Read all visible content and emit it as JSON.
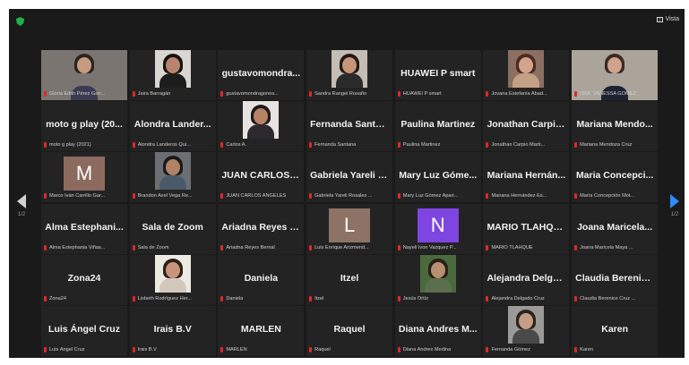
{
  "toolbar": {
    "view_label": "Vista"
  },
  "pagination": {
    "left_page": "1/2",
    "right_page": "1/2"
  },
  "tiles": [
    {
      "big": "",
      "small": "Gloria Edith Pérez Garr...",
      "kind": "photo",
      "bg": "#7a7570",
      "skin": "#c79a82",
      "hair": "#2b2420",
      "shirt": "#3a3a50"
    },
    {
      "big": "",
      "small": "Jaira Barragán",
      "kind": "photo",
      "bg": "#d9d6d2",
      "skin": "#b9846d",
      "hair": "#161413",
      "shirt": "#1d1d1d"
    },
    {
      "big": "gustavomondra...",
      "small": "gustavomondragones...",
      "kind": "text"
    },
    {
      "big": "",
      "small": "Sandra Rangel Rosaño",
      "kind": "photo",
      "bg": "#c3bdb5",
      "skin": "#c89478",
      "hair": "#201915",
      "shirt": "#2b2b2b"
    },
    {
      "big": "HUAWEI P smart",
      "small": "HUAWEI P smart",
      "kind": "text"
    },
    {
      "big": "",
      "small": "Jovana Estefanía Abad...",
      "kind": "photo",
      "bg": "#8a6f62",
      "skin": "#d4a38c",
      "hair": "#4a2b20",
      "shirt": "#c4a084"
    },
    {
      "big": "",
      "small": "DRA. VANESSA GÓMEZ",
      "kind": "photo",
      "bg": "#aaa49b",
      "skin": "#d0a38d",
      "hair": "#3a2a22",
      "shirt": "#1e2230",
      "speaking": true
    },
    {
      "big": "moto g play (20...",
      "small": "moto g play (2021)",
      "kind": "text"
    },
    {
      "big": "Alondra Lander...",
      "small": "Alondra Landeros Qui...",
      "kind": "text"
    },
    {
      "big": "",
      "small": "Carlos A.",
      "kind": "photo",
      "bg": "#e6e3e0",
      "skin": "#b78266",
      "hair": "#1e1b18",
      "shirt": "#2c2a2e"
    },
    {
      "big": "Fernanda Santana",
      "small": "Fernanda Santana",
      "kind": "text"
    },
    {
      "big": "Paulina Martinez",
      "small": "Paulina Martinez",
      "kind": "text"
    },
    {
      "big": "Jonathan Carpio...",
      "small": "Jonathan Carpio Marti...",
      "kind": "text"
    },
    {
      "big": "Mariana Mendo...",
      "small": "Mariana Mendoza Cruz",
      "kind": "text"
    },
    {
      "big": "",
      "small": "Marco Iván Carrillo Gar...",
      "kind": "letter",
      "letter": "M",
      "color": "#8c6b5e"
    },
    {
      "big": "",
      "small": "Brandon Axel Vega Re...",
      "kind": "photo",
      "bg": "#6b6f73",
      "skin": "#b08266",
      "hair": "#1a1a1a",
      "shirt": "#4b5a6b"
    },
    {
      "big": "JUAN CARLOS A...",
      "small": "JUAN CARLOS ANGELES",
      "kind": "text"
    },
    {
      "big": "Gabriela Yareli R...",
      "small": "Gabriela Yareli Rosales ...",
      "kind": "text"
    },
    {
      "big": "Mary Luz Góme...",
      "small": "Mary Luz Gómez Apari...",
      "kind": "text"
    },
    {
      "big": "Mariana Hernán...",
      "small": "Mariana Hernández Es...",
      "kind": "text"
    },
    {
      "big": "Maria Concepci...",
      "small": "María Concepción Mot...",
      "kind": "text"
    },
    {
      "big": "Alma Estephani...",
      "small": "Alma Estephania Viñas...",
      "kind": "text"
    },
    {
      "big": "Sala de Zoom",
      "small": "Sala de Zoom",
      "kind": "text"
    },
    {
      "big": "Ariadna Reyes B...",
      "small": "Ariadna Reyes Bernal",
      "kind": "text"
    },
    {
      "big": "",
      "small": "Luis Enrique Arizmend...",
      "kind": "letter",
      "letter": "L",
      "color": "#8e7266"
    },
    {
      "big": "",
      "small": "Nayeli Ivon Vazquez P...",
      "kind": "letter",
      "letter": "N",
      "color": "#7e45e0"
    },
    {
      "big": "MARIO TLAHQUE",
      "small": "MARIO TLAHQUE",
      "kind": "text"
    },
    {
      "big": "Joana Maricela...",
      "small": "Joana Maricela Maya ...",
      "kind": "text"
    },
    {
      "big": "Zona24",
      "small": "Zona24",
      "kind": "text"
    },
    {
      "big": "",
      "small": "Lisbeth Rodríguez Her...",
      "kind": "photo",
      "bg": "#ece9e3",
      "skin": "#c99479",
      "hair": "#2c201b",
      "shirt": "#d4c8bc"
    },
    {
      "big": "Daniela",
      "small": "Daniela",
      "kind": "text"
    },
    {
      "big": "Itzel",
      "small": "Itzel",
      "kind": "text"
    },
    {
      "big": "",
      "small": "Jesús Ortíz",
      "kind": "photo",
      "bg": "#4a6a3e",
      "skin": "#b9906f",
      "hair": "#262018",
      "shirt": "#5b6e4d"
    },
    {
      "big": "Alejandra Delga...",
      "small": "Alejandra Delgado Cruz",
      "kind": "text"
    },
    {
      "big": "Claudia Berenic...",
      "small": "Claudia Berenice Cruz ...",
      "kind": "text"
    },
    {
      "big": "Luis Ángel Cruz",
      "small": "Luis Ángel Cruz",
      "kind": "text"
    },
    {
      "big": "Irais B.V",
      "small": "Irais B.V",
      "kind": "text"
    },
    {
      "big": "MARLEN",
      "small": "MARLEN",
      "kind": "text"
    },
    {
      "big": "Raquel",
      "small": "Raquel",
      "kind": "text"
    },
    {
      "big": "Diana Andres M...",
      "small": "Diana Andres Medina",
      "kind": "text"
    },
    {
      "big": "",
      "small": "Fernanda Gómez",
      "kind": "photo",
      "bg": "#9c9a98",
      "skin": "#c59c86",
      "hair": "#2a241f",
      "shirt": "#4a4a4a"
    },
    {
      "big": "Karen",
      "small": "Karen",
      "kind": "text"
    }
  ]
}
